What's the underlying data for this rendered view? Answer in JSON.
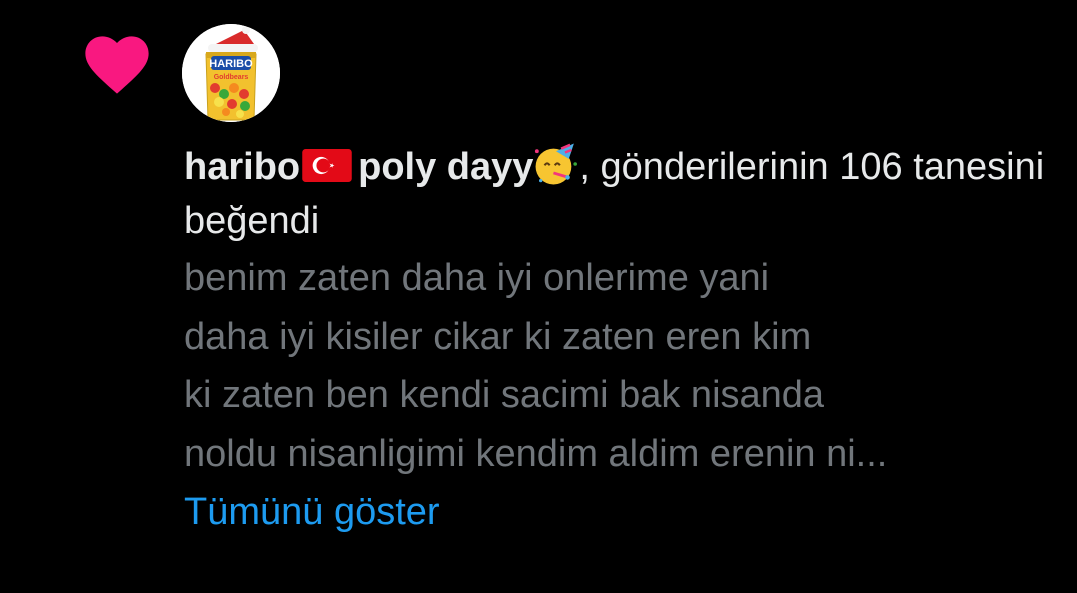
{
  "notification": {
    "icons": {
      "like": "heart-icon",
      "flag": "turkey-flag-icon",
      "emoji": "partying-face-icon"
    },
    "avatar": {
      "brand_text": "HARIBO",
      "product_text": "Goldbears"
    },
    "user_name_first": "haribo",
    "user_name_second": "poly dayy",
    "action_text": ", gönderilerinin 106 tanesini beğendi",
    "post_preview_lines": [
      "benim zaten daha iyi onlerime yani",
      "daha iyi kisiler cikar ki zaten eren kim",
      "ki zaten ben kendi sacimi bak nisanda",
      "noldu nisanligimi kendim aldim erenin ni..."
    ],
    "show_more_label": "Tümünü göster"
  },
  "colors": {
    "background": "#000000",
    "primary_text": "#e7e9ea",
    "secondary_text": "#71767b",
    "link": "#1d9bf0",
    "like": "#f91880"
  }
}
